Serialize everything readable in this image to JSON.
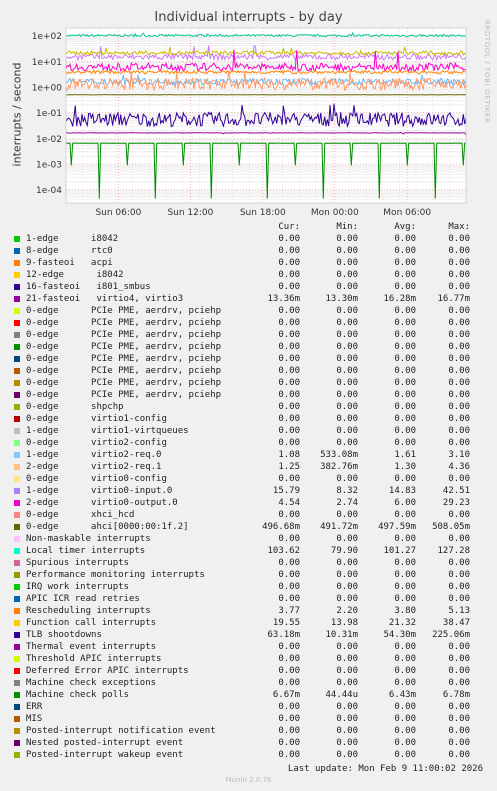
{
  "chart_data": {
    "type": "line",
    "title": "Individual interrupts - by day",
    "ylabel": "interrupts / second",
    "yscale": "log",
    "ylim": [
      3e-05,
      200
    ],
    "yticks": [
      "1e+02",
      "1e+01",
      "1e+00",
      "1e-01",
      "1e-02",
      "1e-03",
      "1e-04"
    ],
    "xticks": [
      "Sun 06:00",
      "Sun 12:00",
      "Sun 18:00",
      "Mon 00:00",
      "Mon 06:00"
    ],
    "grid": true,
    "series": [
      {
        "name": "Local timer interrupts",
        "color": "#00cc99",
        "values": [
          103.62,
          79.9,
          101.27,
          127.28
        ]
      },
      {
        "name": "Machine check polls",
        "color": "#008f00",
        "values": [
          0.00667,
          4.44e-05,
          0.00643,
          0.00678
        ]
      },
      {
        "name": "TLB shootdowns",
        "color": "#330099",
        "values": [
          0.06318,
          0.01031,
          0.0543,
          0.225
        ]
      },
      {
        "name": "virtio0-input.0",
        "color": "#cc77ff",
        "values": [
          15.79,
          8.32,
          14.83,
          42.51
        ]
      },
      {
        "name": "Function call interrupts",
        "color": "#ccbb00",
        "values": [
          19.55,
          13.98,
          21.32,
          38.47
        ]
      },
      {
        "name": "virtio0-output.0",
        "color": "#ff00cc",
        "values": [
          4.54,
          2.74,
          6.0,
          29.23
        ]
      },
      {
        "name": "Rescheduling interrupts",
        "color": "#ff8800",
        "values": [
          3.77,
          2.2,
          3.8,
          5.13
        ]
      },
      {
        "name": "virtio2-req.0",
        "color": "#66bbff",
        "values": [
          1.08,
          0.533,
          1.61,
          3.1
        ]
      },
      {
        "name": "virtio2-req.1",
        "color": "#ff9966",
        "values": [
          1.25,
          0.383,
          1.3,
          4.36
        ]
      },
      {
        "name": "ahci[0000:00:1f.2]",
        "color": "#666600",
        "values": [
          0.4967,
          0.4917,
          0.4976,
          0.508
        ]
      },
      {
        "name": "virtio4, virtio3",
        "color": "#990099",
        "values": [
          0.01336,
          0.0133,
          0.01628,
          0.01677
        ]
      }
    ]
  },
  "legend": {
    "headers": {
      "cur": "Cur:",
      "min": "Min:",
      "avg": "Avg:",
      "max": "Max:"
    },
    "rows": [
      {
        "color": "#00cc00",
        "label": "1-edge      i8042",
        "cur": "0.00",
        "min": "0.00",
        "avg": "0.00",
        "max": "0.00"
      },
      {
        "color": "#0066b3",
        "label": "8-edge      rtc0",
        "cur": "0.00",
        "min": "0.00",
        "avg": "0.00",
        "max": "0.00"
      },
      {
        "color": "#ff8000",
        "label": "9-fasteoi   acpi",
        "cur": "0.00",
        "min": "0.00",
        "avg": "0.00",
        "max": "0.00"
      },
      {
        "color": "#ffcc00",
        "label": "12-edge      i8042",
        "cur": "0.00",
        "min": "0.00",
        "avg": "0.00",
        "max": "0.00"
      },
      {
        "color": "#330099",
        "label": "16-fasteoi   i801_smbus",
        "cur": "0.00",
        "min": "0.00",
        "avg": "0.00",
        "max": "0.00"
      },
      {
        "color": "#990099",
        "label": "21-fasteoi   virtio4, virtio3",
        "cur": "13.36m",
        "min": "13.30m",
        "avg": "16.28m",
        "max": "16.77m"
      },
      {
        "color": "#ccff00",
        "label": "0-edge      PCIe PME, aerdrv, pciehp",
        "cur": "0.00",
        "min": "0.00",
        "avg": "0.00",
        "max": "0.00"
      },
      {
        "color": "#ff0000",
        "label": "0-edge      PCIe PME, aerdrv, pciehp",
        "cur": "0.00",
        "min": "0.00",
        "avg": "0.00",
        "max": "0.00"
      },
      {
        "color": "#808080",
        "label": "0-edge      PCIe PME, aerdrv, pciehp",
        "cur": "0.00",
        "min": "0.00",
        "avg": "0.00",
        "max": "0.00"
      },
      {
        "color": "#008f00",
        "label": "0-edge      PCIe PME, aerdrv, pciehp",
        "cur": "0.00",
        "min": "0.00",
        "avg": "0.00",
        "max": "0.00"
      },
      {
        "color": "#00487d",
        "label": "0-edge      PCIe PME, aerdrv, pciehp",
        "cur": "0.00",
        "min": "0.00",
        "avg": "0.00",
        "max": "0.00"
      },
      {
        "color": "#b35a00",
        "label": "0-edge      PCIe PME, aerdrv, pciehp",
        "cur": "0.00",
        "min": "0.00",
        "avg": "0.00",
        "max": "0.00"
      },
      {
        "color": "#b38f00",
        "label": "0-edge      PCIe PME, aerdrv, pciehp",
        "cur": "0.00",
        "min": "0.00",
        "avg": "0.00",
        "max": "0.00"
      },
      {
        "color": "#6b006b",
        "label": "0-edge      PCIe PME, aerdrv, pciehp",
        "cur": "0.00",
        "min": "0.00",
        "avg": "0.00",
        "max": "0.00"
      },
      {
        "color": "#8fb300",
        "label": "0-edge      shpchp",
        "cur": "0.00",
        "min": "0.00",
        "avg": "0.00",
        "max": "0.00"
      },
      {
        "color": "#b30000",
        "label": "0-edge      virtio1-config",
        "cur": "0.00",
        "min": "0.00",
        "avg": "0.00",
        "max": "0.00"
      },
      {
        "color": "#bebebe",
        "label": "1-edge      virtio1-virtqueues",
        "cur": "0.00",
        "min": "0.00",
        "avg": "0.00",
        "max": "0.00"
      },
      {
        "color": "#80ff80",
        "label": "0-edge      virtio2-config",
        "cur": "0.00",
        "min": "0.00",
        "avg": "0.00",
        "max": "0.00"
      },
      {
        "color": "#80c9ff",
        "label": "1-edge      virtio2-req.0",
        "cur": "1.08",
        "min": "533.08m",
        "avg": "1.61",
        "max": "3.10"
      },
      {
        "color": "#ffc080",
        "label": "2-edge      virtio2-req.1",
        "cur": "1.25",
        "min": "382.76m",
        "avg": "1.30",
        "max": "4.36"
      },
      {
        "color": "#ffe680",
        "label": "0-edge      virtio0-config",
        "cur": "0.00",
        "min": "0.00",
        "avg": "0.00",
        "max": "0.00"
      },
      {
        "color": "#aa80ff",
        "label": "1-edge      virtio0-input.0",
        "cur": "15.79",
        "min": "8.32",
        "avg": "14.83",
        "max": "42.51"
      },
      {
        "color": "#ee00cc",
        "label": "2-edge      virtio0-output.0",
        "cur": "4.54",
        "min": "2.74",
        "avg": "6.00",
        "max": "29.23"
      },
      {
        "color": "#ff8080",
        "label": "0-edge      xhci_hcd",
        "cur": "0.00",
        "min": "0.00",
        "avg": "0.00",
        "max": "0.00"
      },
      {
        "color": "#666600",
        "label": "0-edge      ahci[0000:00:1f.2]",
        "cur": "496.68m",
        "min": "491.72m",
        "avg": "497.59m",
        "max": "508.05m"
      },
      {
        "color": "#ffbfff",
        "label": "Non-maskable interrupts",
        "cur": "0.00",
        "min": "0.00",
        "avg": "0.00",
        "max": "0.00"
      },
      {
        "color": "#00ffcc",
        "label": "Local timer interrupts",
        "cur": "103.62",
        "min": "79.90",
        "avg": "101.27",
        "max": "127.28"
      },
      {
        "color": "#cc6699",
        "label": "Spurious interrupts",
        "cur": "0.00",
        "min": "0.00",
        "avg": "0.00",
        "max": "0.00"
      },
      {
        "color": "#999900",
        "label": "Performance monitoring interrupts",
        "cur": "0.00",
        "min": "0.00",
        "avg": "0.00",
        "max": "0.00"
      },
      {
        "color": "#00cc00",
        "label": "IRQ work interrupts",
        "cur": "0.00",
        "min": "0.00",
        "avg": "0.00",
        "max": "0.00"
      },
      {
        "color": "#0066b3",
        "label": "APIC ICR read retries",
        "cur": "0.00",
        "min": "0.00",
        "avg": "0.00",
        "max": "0.00"
      },
      {
        "color": "#ff8000",
        "label": "Rescheduling interrupts",
        "cur": "3.77",
        "min": "2.20",
        "avg": "3.80",
        "max": "5.13"
      },
      {
        "color": "#ffcc00",
        "label": "Function call interrupts",
        "cur": "19.55",
        "min": "13.98",
        "avg": "21.32",
        "max": "38.47"
      },
      {
        "color": "#330099",
        "label": "TLB shootdowns",
        "cur": "63.18m",
        "min": "10.31m",
        "avg": "54.30m",
        "max": "225.06m"
      },
      {
        "color": "#990099",
        "label": "Thermal event interrupts",
        "cur": "0.00",
        "min": "0.00",
        "avg": "0.00",
        "max": "0.00"
      },
      {
        "color": "#ccff00",
        "label": "Threshold APIC interrupts",
        "cur": "0.00",
        "min": "0.00",
        "avg": "0.00",
        "max": "0.00"
      },
      {
        "color": "#ff0000",
        "label": "Deferred Error APIC interrupts",
        "cur": "0.00",
        "min": "0.00",
        "avg": "0.00",
        "max": "0.00"
      },
      {
        "color": "#808080",
        "label": "Machine check exceptions",
        "cur": "0.00",
        "min": "0.00",
        "avg": "0.00",
        "max": "0.00"
      },
      {
        "color": "#008f00",
        "label": "Machine check polls",
        "cur": "6.67m",
        "min": "44.44u",
        "avg": "6.43m",
        "max": "6.78m"
      },
      {
        "color": "#00487d",
        "label": "ERR",
        "cur": "0.00",
        "min": "0.00",
        "avg": "0.00",
        "max": "0.00"
      },
      {
        "color": "#b35a00",
        "label": "MIS",
        "cur": "0.00",
        "min": "0.00",
        "avg": "0.00",
        "max": "0.00"
      },
      {
        "color": "#b38f00",
        "label": "Posted-interrupt notification event",
        "cur": "0.00",
        "min": "0.00",
        "avg": "0.00",
        "max": "0.00"
      },
      {
        "color": "#6b006b",
        "label": "Nested posted-interrupt event",
        "cur": "0.00",
        "min": "0.00",
        "avg": "0.00",
        "max": "0.00"
      },
      {
        "color": "#8fb300",
        "label": "Posted-interrupt wakeup event",
        "cur": "0.00",
        "min": "0.00",
        "avg": "0.00",
        "max": "0.00"
      }
    ]
  },
  "footer": {
    "last_update": "Last update: Mon Feb  9 11:00:02 2026",
    "munin": "Munin 2.0.76",
    "side_credit": "RRDTOOL / TOBI OETIKER"
  }
}
